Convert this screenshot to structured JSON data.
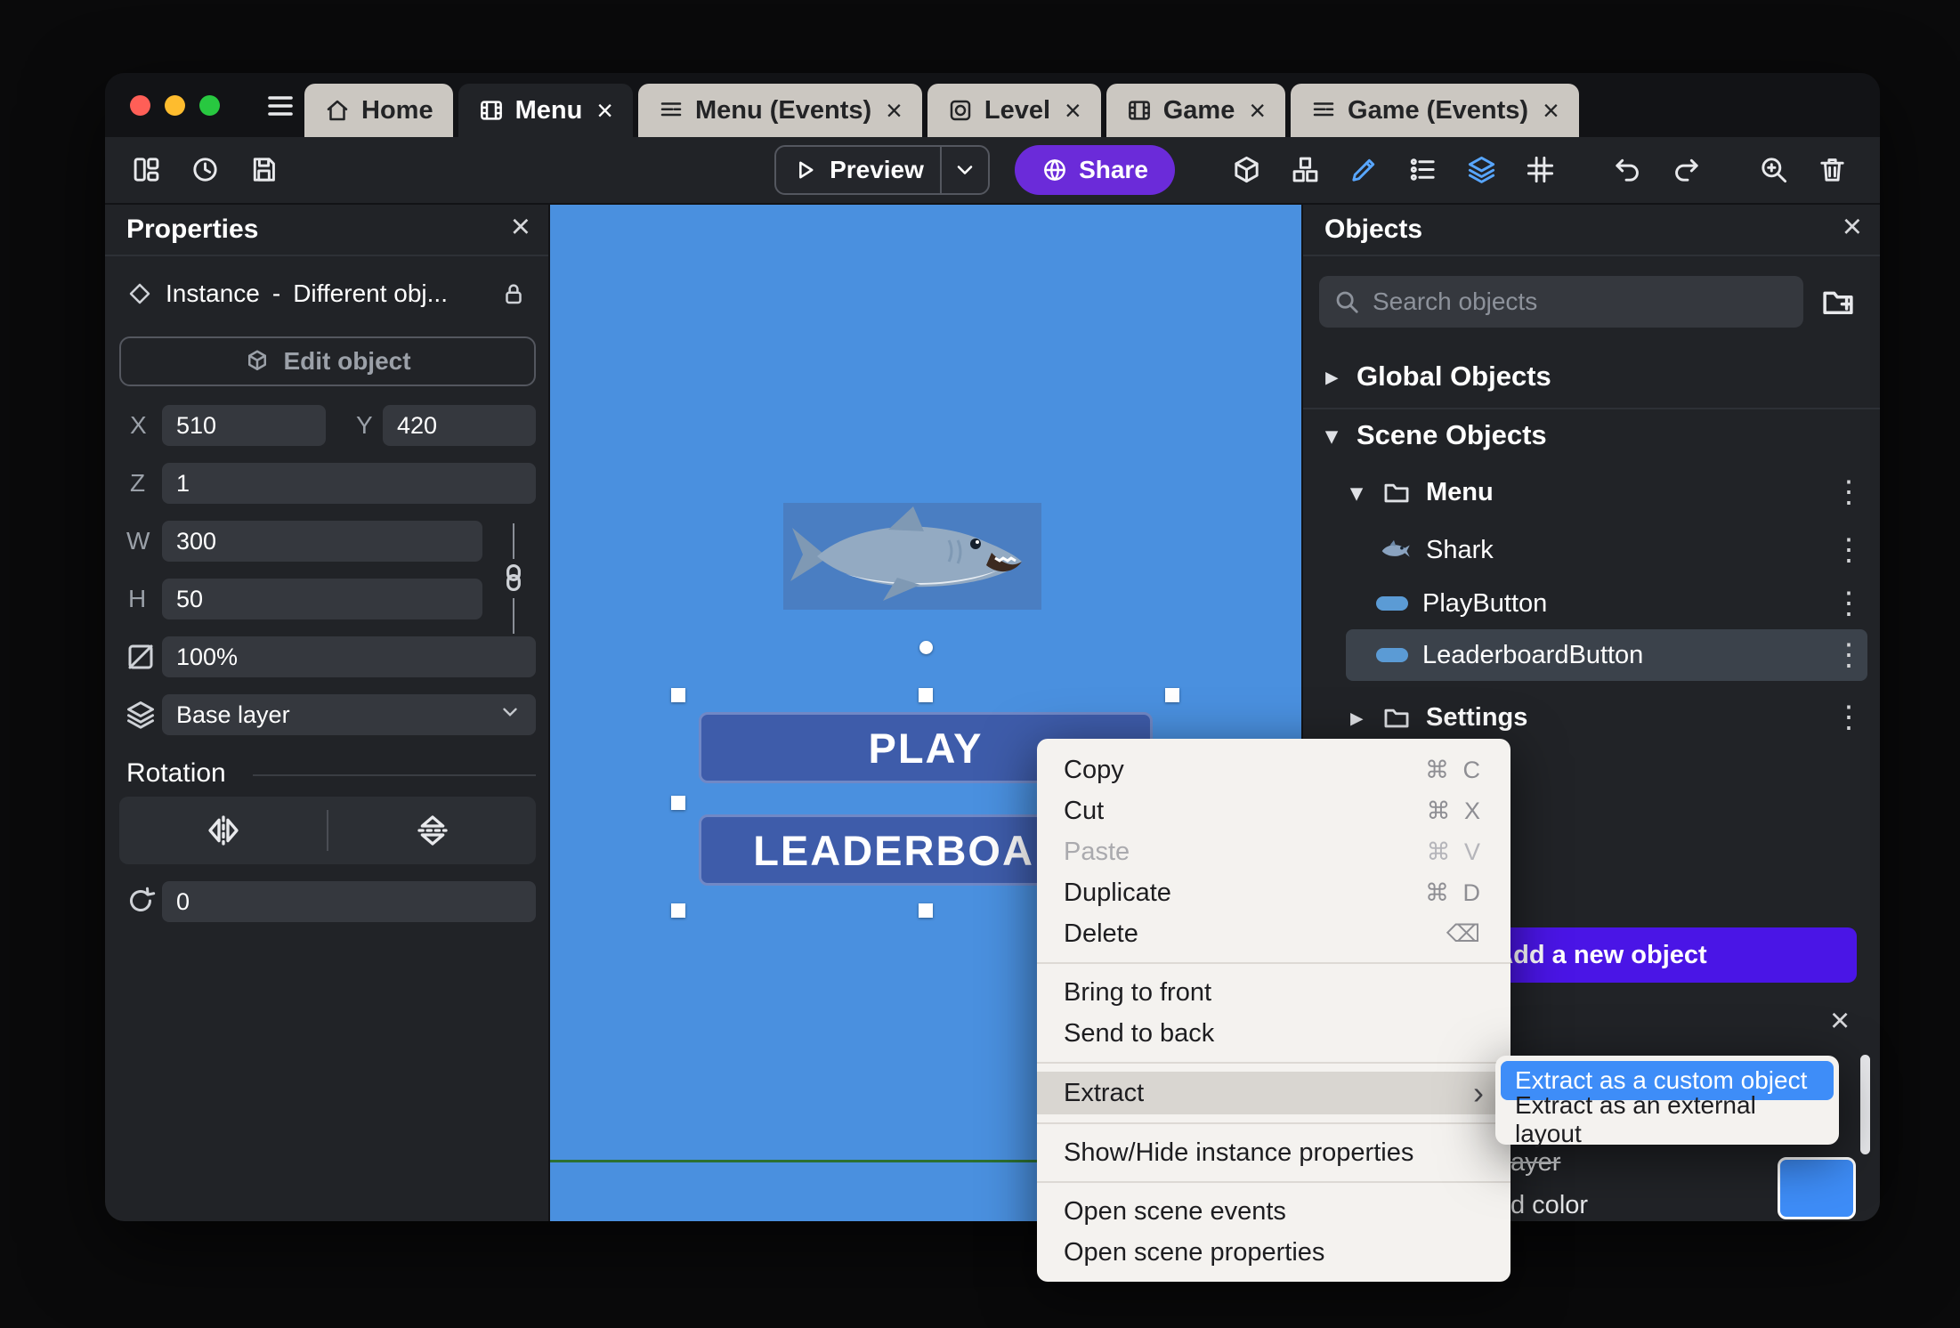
{
  "colors": {
    "accent_purple": "#6b2bd9",
    "add_button_purple": "#4a15e6",
    "selection_blue": "#3e8df8",
    "canvas_blue": "#4a90df"
  },
  "window": {
    "close_glyph": "×",
    "tabs": [
      {
        "label": "Home",
        "icon": "home-icon",
        "active": false,
        "closable": false
      },
      {
        "label": "Menu",
        "icon": "film-icon",
        "active": true,
        "closable": true
      },
      {
        "label": "Menu (Events)",
        "icon": "events-icon",
        "active": false,
        "closable": true
      },
      {
        "label": "Level",
        "icon": "level-icon",
        "active": false,
        "closable": true
      },
      {
        "label": "Game",
        "icon": "film-icon",
        "active": false,
        "closable": true
      },
      {
        "label": "Game (Events)",
        "icon": "events-icon",
        "active": false,
        "closable": true
      }
    ]
  },
  "toolbar": {
    "preview_label": "Preview",
    "share_label": "Share",
    "left_icons": [
      "panels-icon",
      "history-icon",
      "save-icon"
    ],
    "right_icons": [
      "box-3d-icon",
      "object-group-icon",
      "pencil-icon",
      "instances-list-icon",
      "layers-icon",
      "grid-icon",
      "undo-icon",
      "redo-icon",
      "zoom-in-icon",
      "trash-icon",
      "edit-scene-icon"
    ],
    "active_icons": [
      "pencil-icon",
      "layers-icon"
    ]
  },
  "properties": {
    "title": "Properties",
    "instance_type": "Instance",
    "dash": "-",
    "instance_name": "Different obj...",
    "edit_object": "Edit object",
    "x_label": "X",
    "x": "510",
    "y_label": "Y",
    "y": "420",
    "z_label": "Z",
    "z": "1",
    "w_label": "W",
    "w": "300",
    "h_label": "H",
    "h": "50",
    "opacity": "100%",
    "layer": "Base layer",
    "rotation_title": "Rotation",
    "rotation": "0"
  },
  "canvas": {
    "play": "PLAY",
    "leaderboard": "LEADERBOARD"
  },
  "context_menu": {
    "copy": {
      "label": "Copy",
      "shortcut": "⌘ C"
    },
    "cut": {
      "label": "Cut",
      "shortcut": "⌘ X"
    },
    "paste": {
      "label": "Paste",
      "shortcut": "⌘ V"
    },
    "duplicate": {
      "label": "Duplicate",
      "shortcut": "⌘ D"
    },
    "delete": {
      "label": "Delete",
      "shortcut": "⌫"
    },
    "bring_to_front": "Bring to front",
    "send_to_back": "Send to back",
    "extract": "Extract",
    "extract_arrow": "›",
    "show_hide": "Show/Hide instance properties",
    "open_scene_events": "Open scene events",
    "open_scene_properties": "Open scene properties",
    "submenu": {
      "custom_object": "Extract as a custom object",
      "external_layout": "Extract as an external layout"
    }
  },
  "objects_panel": {
    "title": "Objects",
    "search_placeholder": "Search objects",
    "global_objects": "Global Objects",
    "scene_objects": "Scene Objects",
    "caret_collapsed": "▸",
    "caret_expanded": "▾",
    "kebab": "⋮",
    "menu_folder": "Menu",
    "shark": "Shark",
    "play_button": "PlayButton",
    "leaderboard_button": "LeaderboardButton",
    "settings_folder": "Settings",
    "add_object_plus": "+",
    "add_object": "Add a new object",
    "fragments": {
      "layer": "ayer",
      "color": "d color"
    }
  }
}
